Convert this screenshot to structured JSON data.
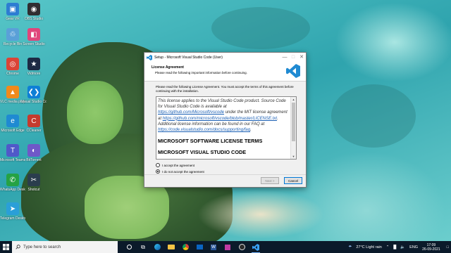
{
  "desktop": {
    "icons": [
      {
        "label": "Gear VR",
        "color": "#2d7dd2",
        "glyph": "▣"
      },
      {
        "label": "OBS Studio",
        "color": "#302e31",
        "glyph": "◉"
      },
      {
        "label": "Recycle Bin",
        "color": "#5aa0d8",
        "glyph": "♲"
      },
      {
        "label": "Screen Studio",
        "color": "#e0457b",
        "glyph": "◧"
      },
      {
        "label": "Chrome",
        "color": "#db4437",
        "glyph": "◎"
      },
      {
        "label": "Vidmore",
        "color": "#1d2a44",
        "glyph": "★"
      },
      {
        "label": "VLC media player",
        "color": "#f08a1c",
        "glyph": "▲"
      },
      {
        "label": "Visual Studio Code",
        "color": "#0e7fd6",
        "glyph": "❮❯"
      },
      {
        "label": "Microsoft Edge",
        "color": "#1f8ad2",
        "glyph": "e"
      },
      {
        "label": "CCleaner",
        "color": "#c53b2e",
        "glyph": "C"
      },
      {
        "label": "Microsoft Teams",
        "color": "#5059c9",
        "glyph": "T"
      },
      {
        "label": "BitTorrent",
        "color": "#6f58c8",
        "glyph": "◐"
      },
      {
        "label": "WhatsApp Desktop",
        "color": "#25a244",
        "glyph": "✆"
      },
      {
        "label": "Shotcut",
        "color": "#2a3d4d",
        "glyph": "✂"
      },
      {
        "label": "Telegram Desktop",
        "color": "#2a9fd8",
        "glyph": "➤"
      }
    ]
  },
  "dialog": {
    "title": "Setup - Microsoft Visual Studio Code (User)",
    "header_title": "License Agreement",
    "header_subtitle": "Please read the following important information before continuing.",
    "intro": "Please read the following License Agreement. You must accept the terms of this agreement before continuing with the installation.",
    "license": {
      "p1_a": "This license applies to the Visual Studio Code product. Source Code for Visual Studio Code is available at ",
      "p1_link1": "https://github.com/Microsoft/vscode",
      "p1_b": " under the MIT license agreement at ",
      "p1_link2": "https://github.com/microsoft/vscode/blob/master/LICENSE.txt",
      "p1_c": ". Additional license information can be found in our FAQ at ",
      "p1_link3": "https://code.visualstudio.com/docs/supporting/faq",
      "p1_d": ".",
      "heading1": "MICROSOFT SOFTWARE LICENSE TERMS",
      "heading2": "MICROSOFT VISUAL STUDIO CODE"
    },
    "radio_accept": "I accept the agreement",
    "radio_decline": "I do not accept the agreement",
    "selected": "decline",
    "next_label": "Next >",
    "cancel_label": "Cancel"
  },
  "taskbar": {
    "search_placeholder": "Type here to search",
    "weather": "27°C  Light rain",
    "language": "ENG",
    "time": "17:09",
    "date": "26-09-2021"
  }
}
